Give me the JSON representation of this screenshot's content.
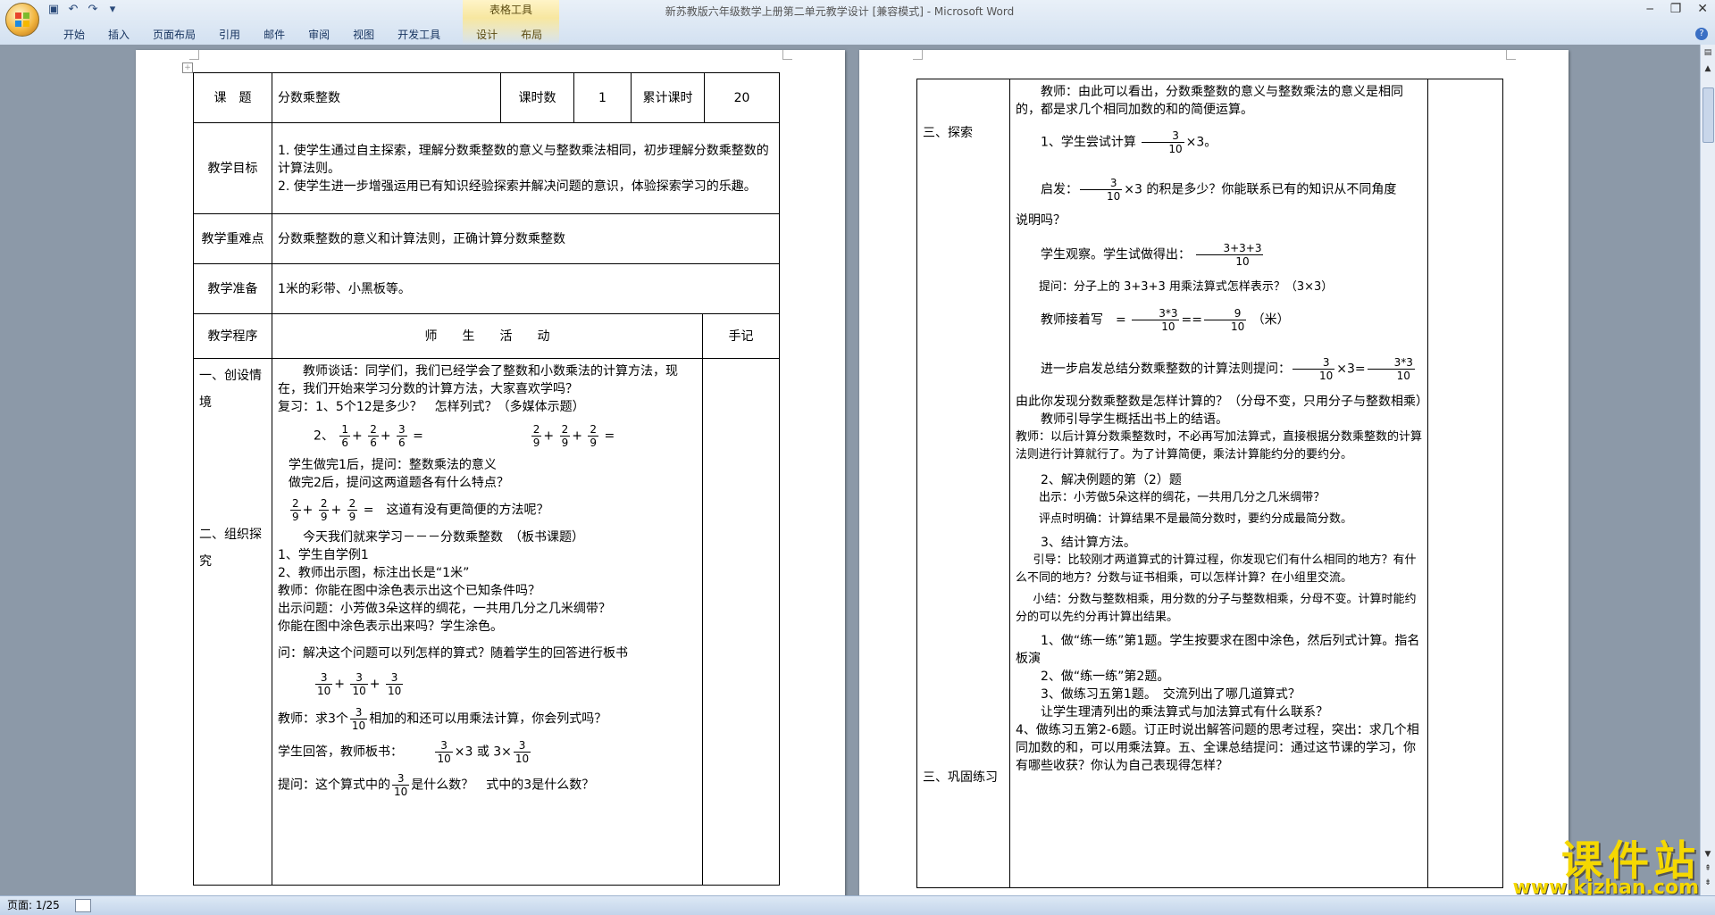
{
  "window": {
    "title": "新苏教版六年级数学上册第二单元教学设计 [兼容模式] - Microsoft Word",
    "context_tab_group": "表格工具",
    "tabs": [
      "开始",
      "插入",
      "页面布局",
      "引用",
      "邮件",
      "审阅",
      "视图",
      "开发工具",
      "设计",
      "布局"
    ]
  },
  "status": {
    "page": "页面: 1/25"
  },
  "page1": {
    "header": {
      "topic_label": "课　题",
      "topic": "分数乘整数",
      "hours_label": "课时数",
      "hours": "1",
      "total_label": "累计课时",
      "total": "20"
    },
    "goals_label": "教学目标",
    "goals": [
      "1. 使学生通过自主探索，理解分数乘整数的意义与整数乘法相同，初步理解分数乘整数的计算法则。",
      "2. 使学生进一步增强运用已有知识经验探索并解决问题的意识，体验探索学习的乐趣。"
    ],
    "key_label": "教学重难点",
    "key": "分数乘整数的意义和计算法则，正确计算分数乘整数",
    "prep_label": "教学准备",
    "prep": "1米的彩带、小黑板等。",
    "proc_label": "教学程序",
    "activity_label": "师　　生　　活　　动",
    "notes_label": "手记",
    "sec1": "一、创设情境",
    "sec2": "二、组织探究",
    "lines": {
      "l1": "教师谈话：同学们，我们已经学会了整数和小数乘法的计算方法，现在，我们开始来学习分数的计算方法，大家喜欢学吗？",
      "l2": "复习：1、5个12是多少？　怎样列式？（多媒体示题）",
      "l3a": "2、",
      "l4": "学生做完1后，提问：整数乘法的意义",
      "l5": "做完2后，提问这两道题各有什么特点？",
      "l6": "这道有没有更简便的方法呢？",
      "l7": "今天我们就来学习－－－分数乘整数　（板书课题）",
      "l8": "1、学生自学例1",
      "l9": "2、教师出示图，标注出长是“1米”",
      "l10": "教师：你能在图中涂色表示出这个已知条件吗？",
      "l11": "出示问题：小芳做3朵这样的绸花，一共用几分之几米绸带？",
      "l12": "你能在图中涂色表示出来吗？学生涂色。",
      "l13": "问：解决这个问题可以列怎样的算式？随着学生的回答进行板书",
      "l14a": "教师：求3个",
      "l14b": "相加的和还可以用乘法计算，你会列式吗？",
      "l15a": "学生回答，教师板书：",
      "l15b": "×3 或 3×",
      "l16a": "提问：这个算式中的",
      "l16b": "是什么数？　式中的3是什么数？"
    }
  },
  "page2": {
    "sec3": "三、探索",
    "sec4": "三、巩固练习",
    "lines": {
      "m1": "教师：由此可以看出，分数乘整数的意义与整数乘法的意义是相同的，都是求几个相同加数的和的简便运算。",
      "m2a": "1、学生尝试计算",
      "m2b": "×3。",
      "m3a": "启发：",
      "m3b": "×3 的积是多少？你能联系已有的知识从不同角度",
      "m3c": "说明吗？",
      "m4": "学生观察。学生试做得出：",
      "m5": "提问：分子上的 3+3+3 用乘法算式怎样表示？（3×3）",
      "m6a": "教师接着写",
      "m6b": "（米）",
      "m7a": "进一步启发总结分数乘整数的计算法则提问：",
      "m7b": "×3=",
      "m8": "由此你发现分数乘整数是怎样计算的？（分母不变，只用分子与整数相乘）",
      "m9": "教师引导学生概括出书上的结语。",
      "m10": "教师：以后计算分数乘整数时，不必再写加法算式，直接根据分数乘整数的计算法则进行计算就行了。为了计算简便，乘法计算能约分的要约分。",
      "m11": "2、解决例题的第（2）题",
      "m12": "出示：小芳做5朵这样的绸花，一共用几分之几米绸带？",
      "m13": "评点时明确：计算结果不是最简分数时，要约分成最简分数。",
      "m14": "3、结计算方法。",
      "m15": "引导：比较刚才两道算式的计算过程，你发现它们有什么相同的地方？有什么不同的地方？分数与证书相乘，可以怎样计算？在小组里交流。",
      "m16": "小结：分数与整数相乘，用分数的分子与整数相乘，分母不变。计算时能约分的可以先约分再计算出结果。",
      "m17": "1、做“练一练”第1题。学生按要求在图中涂色，然后列式计算。指名板演",
      "m18": "2、做“练一练”第2题。",
      "m19": "3、做练习五第1题。　交流列出了哪几道算式？",
      "m20": "让学生理清列出的乘法算式与加法算式有什么联系？",
      "m21": "4、做练习五第2-6题。订正时说出解答问题的思考过程，突出：求几个相同加数的和，可以用乘法算。五、全课总结提问：通过这节课的学习，你有哪些收获？你认为自己表现得怎样？"
    }
  },
  "math": {
    "f1": [
      "1",
      "6"
    ],
    "f2": [
      "2",
      "6"
    ],
    "f3": [
      "3",
      "6"
    ],
    "eq": "=",
    "g": [
      "2",
      "9"
    ],
    "t": [
      "3",
      "10"
    ],
    "sum": [
      "3+3+3",
      "10"
    ],
    "prod": [
      "3*3",
      "10"
    ],
    "res": [
      "9",
      "10"
    ]
  },
  "watermark": {
    "cn": "课件站",
    "url": "www.kjzhan.com"
  }
}
